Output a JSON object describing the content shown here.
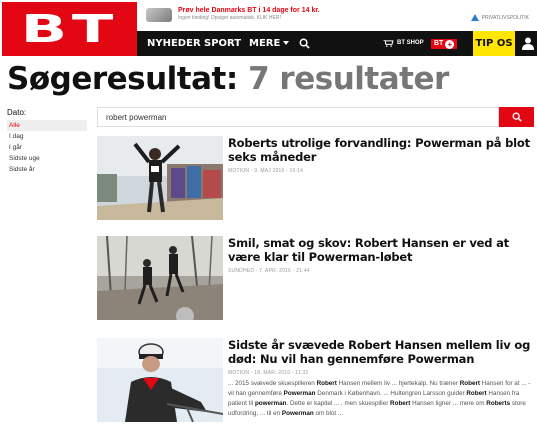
{
  "header": {
    "logo_text": "BT",
    "promo_main": "Prøv hele Danmarks BT i 14 dage for 14 kr.",
    "promo_sub": "Ingen binding! Opsiger automatisk. KLIK HER!",
    "adchoice": "PRIVATLIVSPOLITIK",
    "nav": {
      "nyheder": "NYHEDER",
      "sport": "SPORT",
      "mere": "MERE"
    },
    "shop": "BT SHOP",
    "btplus": "BT",
    "tipos": "TIP OS"
  },
  "page": {
    "title_lead": "Søgeresultat:",
    "title_count": "7 resultater"
  },
  "filters": {
    "label": "Dato:",
    "items": [
      "Alle",
      "I dag",
      "I går",
      "Sidste uge",
      "Sidste år"
    ]
  },
  "search": {
    "value": "robert powerman"
  },
  "results": [
    {
      "title": "Roberts utrolige forvandling: Powerman på blot seks måneder",
      "meta": "MOTION - 9. MAJ 2016 - 10:14"
    },
    {
      "title": "Smil, smat og skov: Robert Hansen er ved at være klar til Powerman-løbet",
      "meta": "SUNDHED - 7. APR. 2016 - 21:44"
    },
    {
      "title": "Sidste år svævede Robert Hansen mellem liv og død: Nu vil han gennemføre Powerman",
      "meta": "MOTION - 18. MAR. 2016 - 11:32",
      "snippet": [
        [
          "... 2015 svævede skuespilleren ",
          false
        ],
        [
          "Robert",
          true
        ],
        [
          " Hansen mellem liv ... hjertekalp. Nu træner ",
          false
        ],
        [
          "Robert",
          true
        ],
        [
          " Hansen for at ... - vil han gennemføre ",
          false
        ],
        [
          "Powerman",
          true
        ],
        [
          " Denmark i København. ... Hultengren Larsson guider ",
          false
        ],
        [
          "Robert",
          true
        ],
        [
          " Hansen fra patient til ",
          false
        ],
        [
          "powerman",
          true
        ],
        [
          ". Dette er kapitel ... , men skuespiller ",
          false
        ],
        [
          "Robert",
          true
        ],
        [
          " Hansen ligner ... mere om ",
          false
        ],
        [
          "Roberts",
          true
        ],
        [
          " store udfordring, ... til en ",
          false
        ],
        [
          "Powerman",
          true
        ],
        [
          " om blot ...",
          false
        ]
      ]
    }
  ],
  "colors": {
    "brand_red": "#e30613",
    "nav_black": "#111111",
    "tipos_yellow": "#ffe500"
  }
}
